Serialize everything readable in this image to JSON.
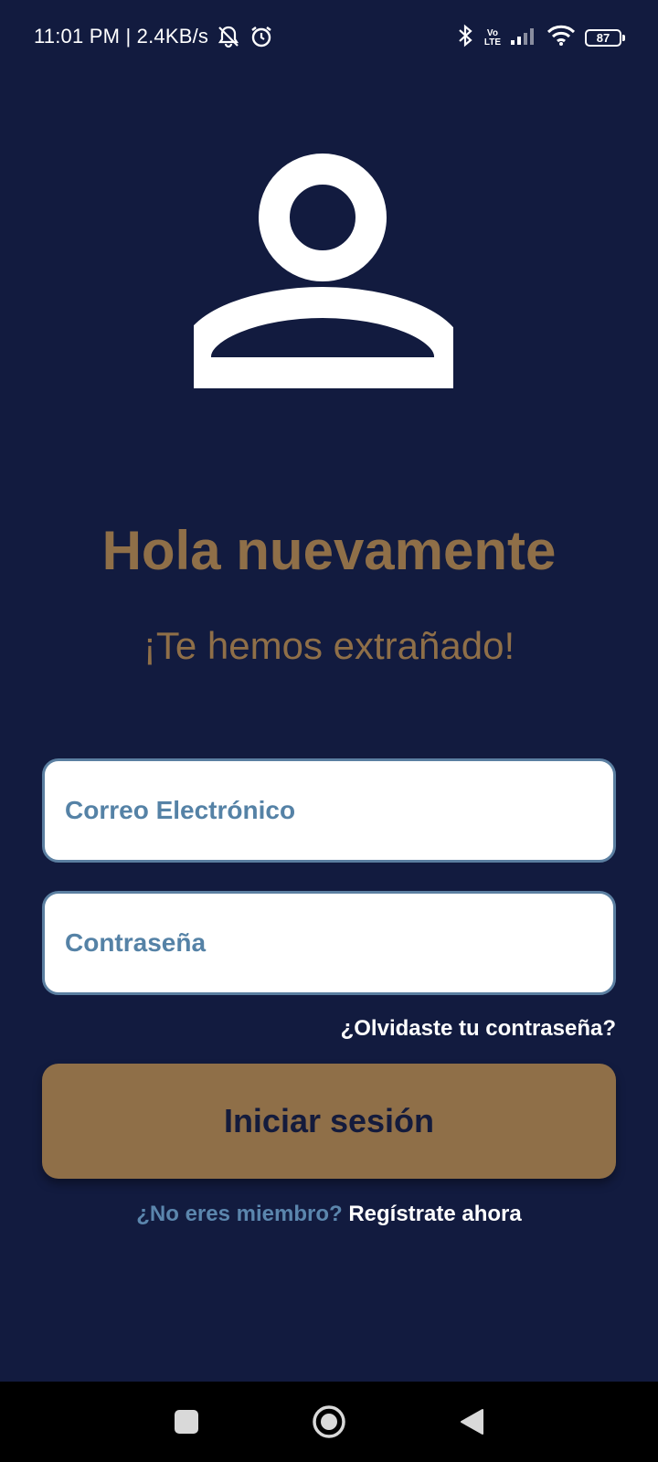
{
  "status_bar": {
    "time_info": "11:01 PM | 2.4KB/s",
    "battery": "87",
    "volte_top": "Vo",
    "volte_bottom": "LTE",
    "icons": [
      "muted-bell-icon",
      "alarm-icon",
      "bluetooth-icon",
      "volte-icon",
      "signal-icon",
      "wifi-icon",
      "battery-icon"
    ]
  },
  "avatar": {
    "icon": "user-icon"
  },
  "heading": {
    "title": "Hola nuevamente",
    "subtitle": "¡Te hemos extrañado!"
  },
  "form": {
    "email_placeholder": "Correo Electrónico",
    "password_placeholder": "Contraseña",
    "email_value": "",
    "password_value": "",
    "forgot_label": "¿Olvidaste tu contraseña?",
    "login_label": "Iniciar sesión",
    "register_question": "¿No eres miembro?",
    "register_link": "Regístrate ahora"
  },
  "nav": {
    "icons": [
      "recent-apps-icon",
      "home-icon",
      "back-icon"
    ]
  },
  "colors": {
    "background": "#121b3f",
    "accent": "#8f6f48",
    "field_border": "#5b7fa1",
    "placeholder": "#5582a6"
  }
}
